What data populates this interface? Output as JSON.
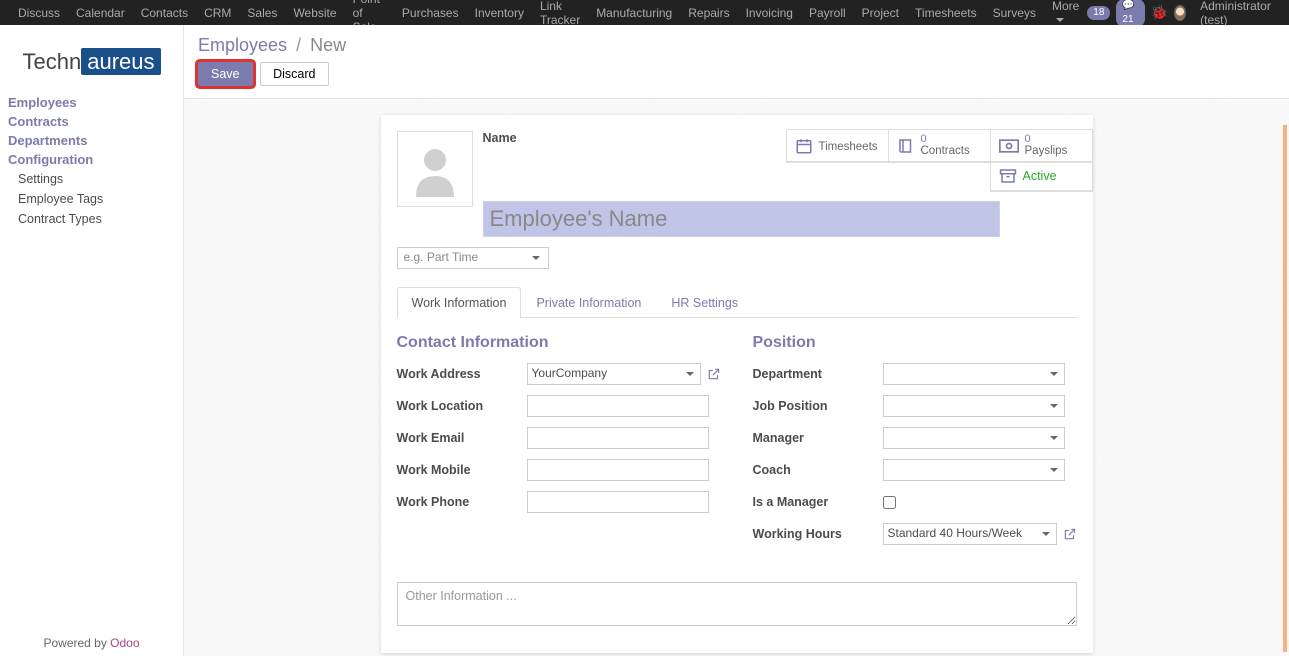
{
  "topnav": {
    "items": [
      "Discuss",
      "Calendar",
      "Contacts",
      "CRM",
      "Sales",
      "Website",
      "Point of Sale",
      "Purchases",
      "Inventory",
      "Link Tracker",
      "Manufacturing",
      "Repairs",
      "Invoicing",
      "Payroll",
      "Project",
      "Timesheets",
      "Surveys",
      "More"
    ],
    "badge1": "18",
    "badge2": "21",
    "user": "Administrator (test)"
  },
  "logo": {
    "part1": "Techn",
    "part2": "aureus"
  },
  "sidebar": {
    "main": [
      "Employees",
      "Contracts",
      "Departments",
      "Configuration"
    ],
    "sub": [
      "Settings",
      "Employee Tags",
      "Contract Types"
    ],
    "powered_by": "Powered by ",
    "powered_link": "Odoo"
  },
  "breadcrumb": {
    "root": "Employees",
    "sep": "/",
    "current": "New"
  },
  "buttons": {
    "save": "Save",
    "discard": "Discard"
  },
  "stats": {
    "timesheets": "Timesheets",
    "contracts_n": "0",
    "contracts": "Contracts",
    "payslips_n": "0",
    "payslips": "Payslips",
    "active": "Active"
  },
  "form": {
    "name_label": "Name",
    "name_placeholder": "Employee's Name",
    "tag_placeholder": "e.g. Part Time"
  },
  "tabs": [
    "Work Information",
    "Private Information",
    "HR Settings"
  ],
  "sections": {
    "contact": "Contact Information",
    "position": "Position"
  },
  "fields": {
    "work_address": "Work Address",
    "work_address_val": "YourCompany",
    "work_location": "Work Location",
    "work_email": "Work Email",
    "work_mobile": "Work Mobile",
    "work_phone": "Work Phone",
    "department": "Department",
    "job_position": "Job Position",
    "manager": "Manager",
    "coach": "Coach",
    "is_manager": "Is a Manager",
    "working_hours": "Working Hours",
    "working_hours_val": "Standard 40 Hours/Week"
  },
  "other_info_placeholder": "Other Information ..."
}
